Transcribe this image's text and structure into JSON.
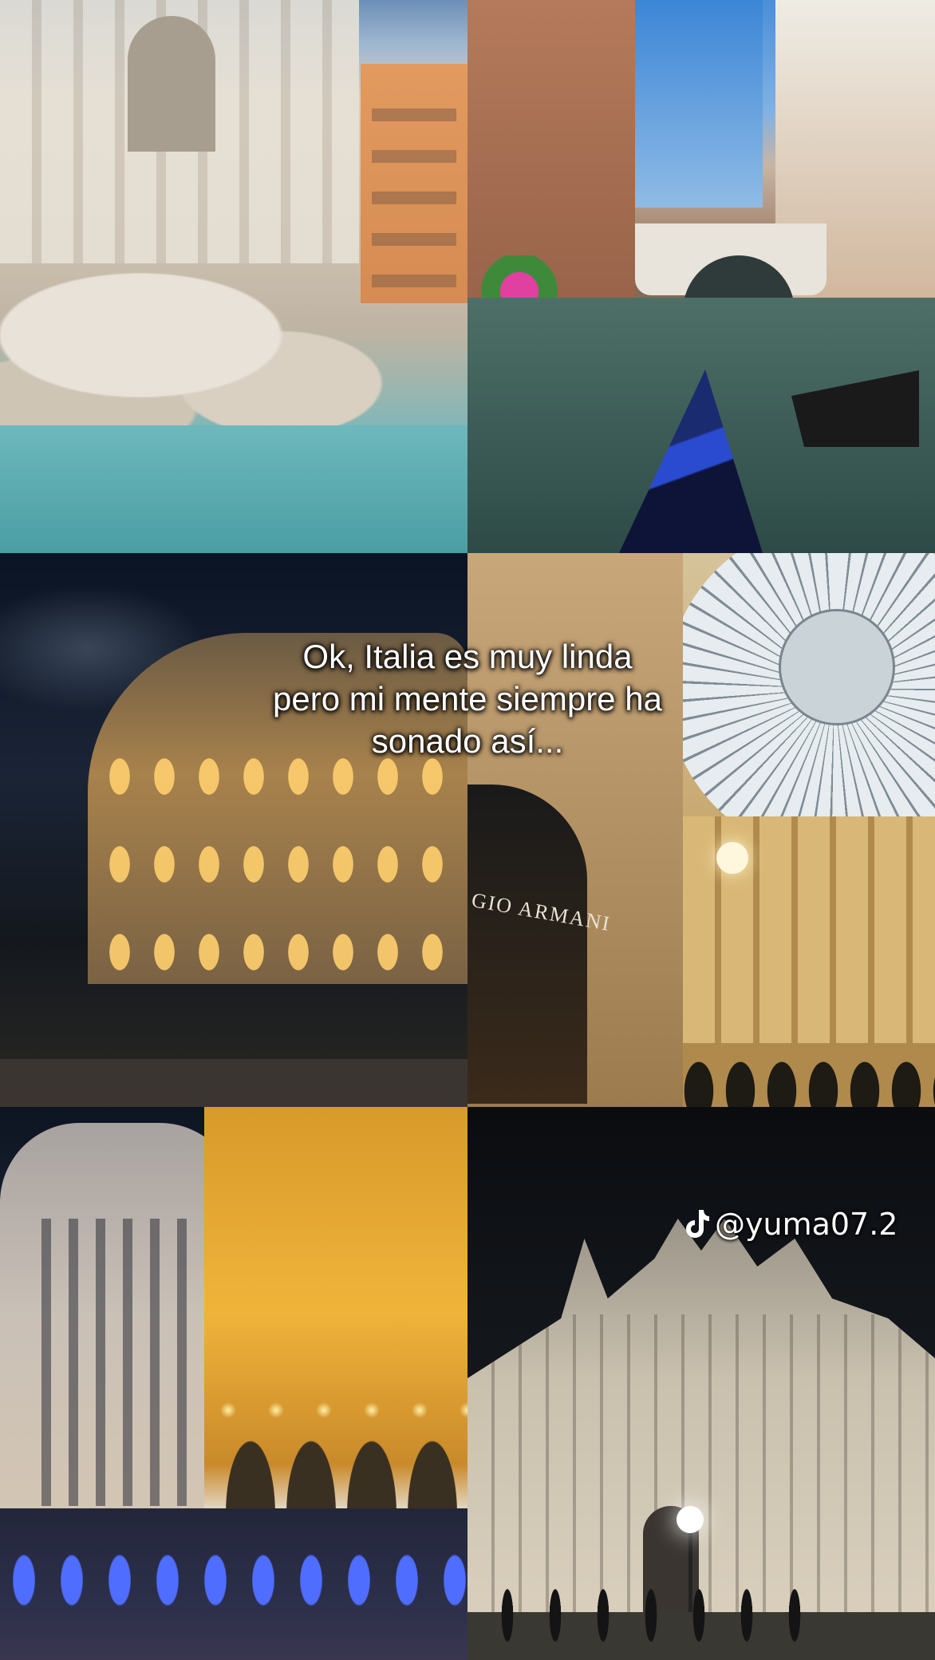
{
  "overlay": {
    "caption_lines": [
      "Ok, Italia es muy linda",
      "pero mi mente siempre ha",
      "sonado así..."
    ],
    "watermark": {
      "icon": "tiktok-logo-icon",
      "handle": "@yuma07.2"
    },
    "signage": {
      "store_sign": "GIO ARMANI"
    }
  },
  "colors": {
    "caption_text": "#ffffff",
    "caption_shadow": "#000000",
    "fountain_light": "#4f6dff",
    "gondola_blue": "#2a4bd0"
  }
}
